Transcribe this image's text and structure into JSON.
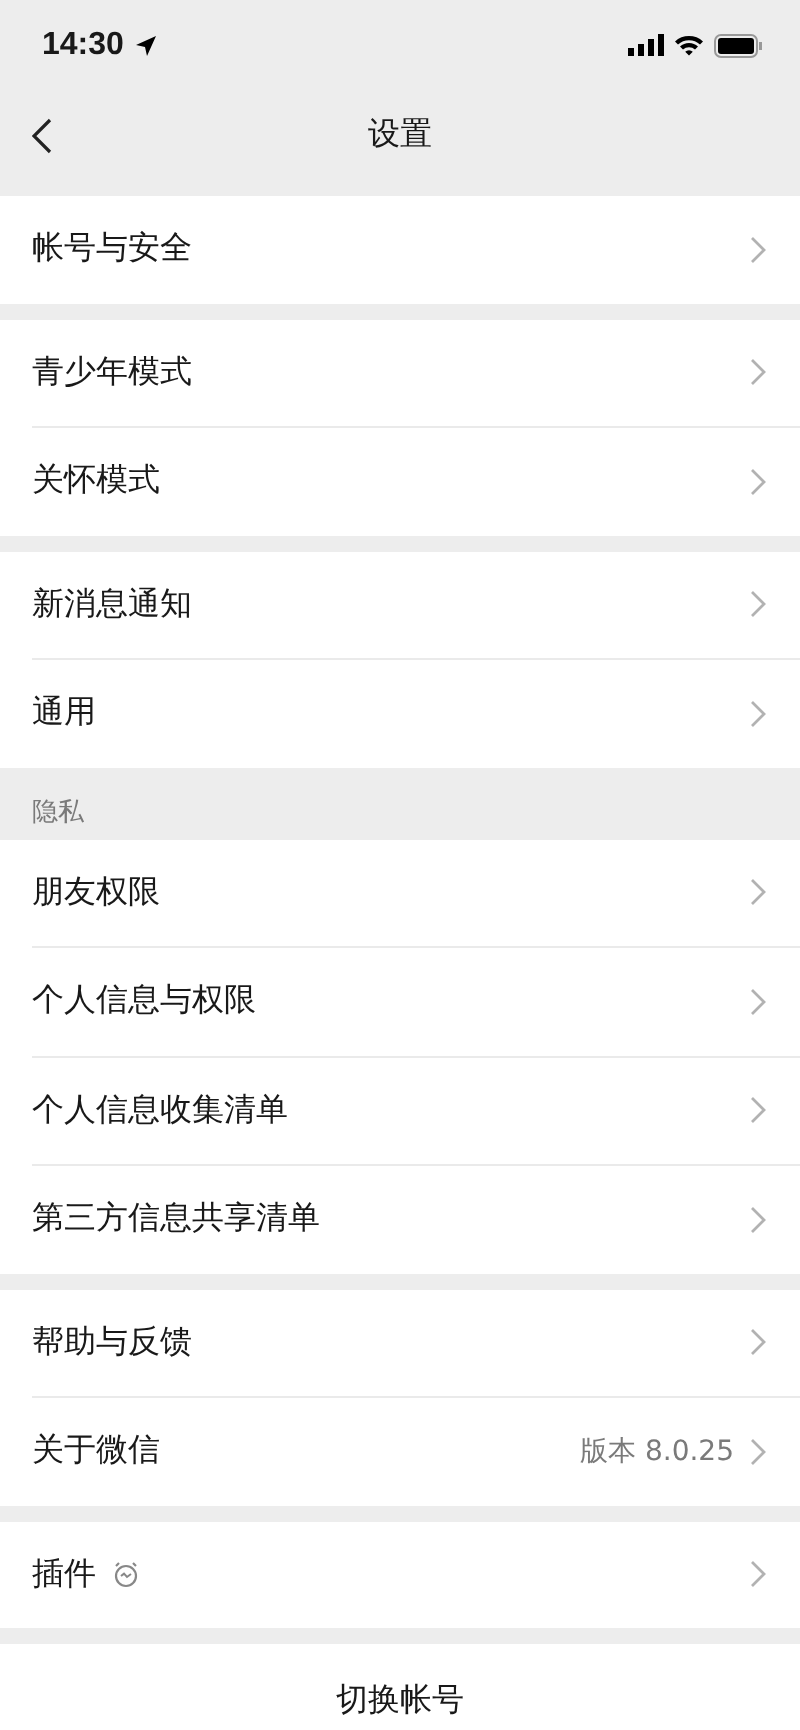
{
  "status_bar": {
    "time": "14:30"
  },
  "nav": {
    "title": "设置"
  },
  "groups": [
    {
      "items": [
        {
          "label": "帐号与安全",
          "kind": "plain"
        }
      ]
    },
    {
      "items": [
        {
          "label": "青少年模式",
          "kind": "plain"
        },
        {
          "label": "关怀模式",
          "kind": "plain"
        }
      ]
    },
    {
      "items": [
        {
          "label": "新消息通知",
          "kind": "plain"
        },
        {
          "label": "通用",
          "kind": "plain"
        }
      ]
    },
    {
      "header": "隐私",
      "items": [
        {
          "label": "朋友权限",
          "kind": "plain"
        },
        {
          "label": "个人信息与权限",
          "kind": "plain"
        },
        {
          "label": "个人信息收集清单",
          "kind": "plain"
        },
        {
          "label": "第三方信息共享清单",
          "kind": "plain"
        }
      ]
    },
    {
      "items": [
        {
          "label": "帮助与反馈",
          "kind": "plain"
        },
        {
          "label": "关于微信",
          "kind": "value",
          "value": "版本 8.0.25"
        }
      ]
    },
    {
      "items": [
        {
          "label": "插件",
          "kind": "icon"
        }
      ]
    }
  ],
  "bottom_button": "切换帐号"
}
